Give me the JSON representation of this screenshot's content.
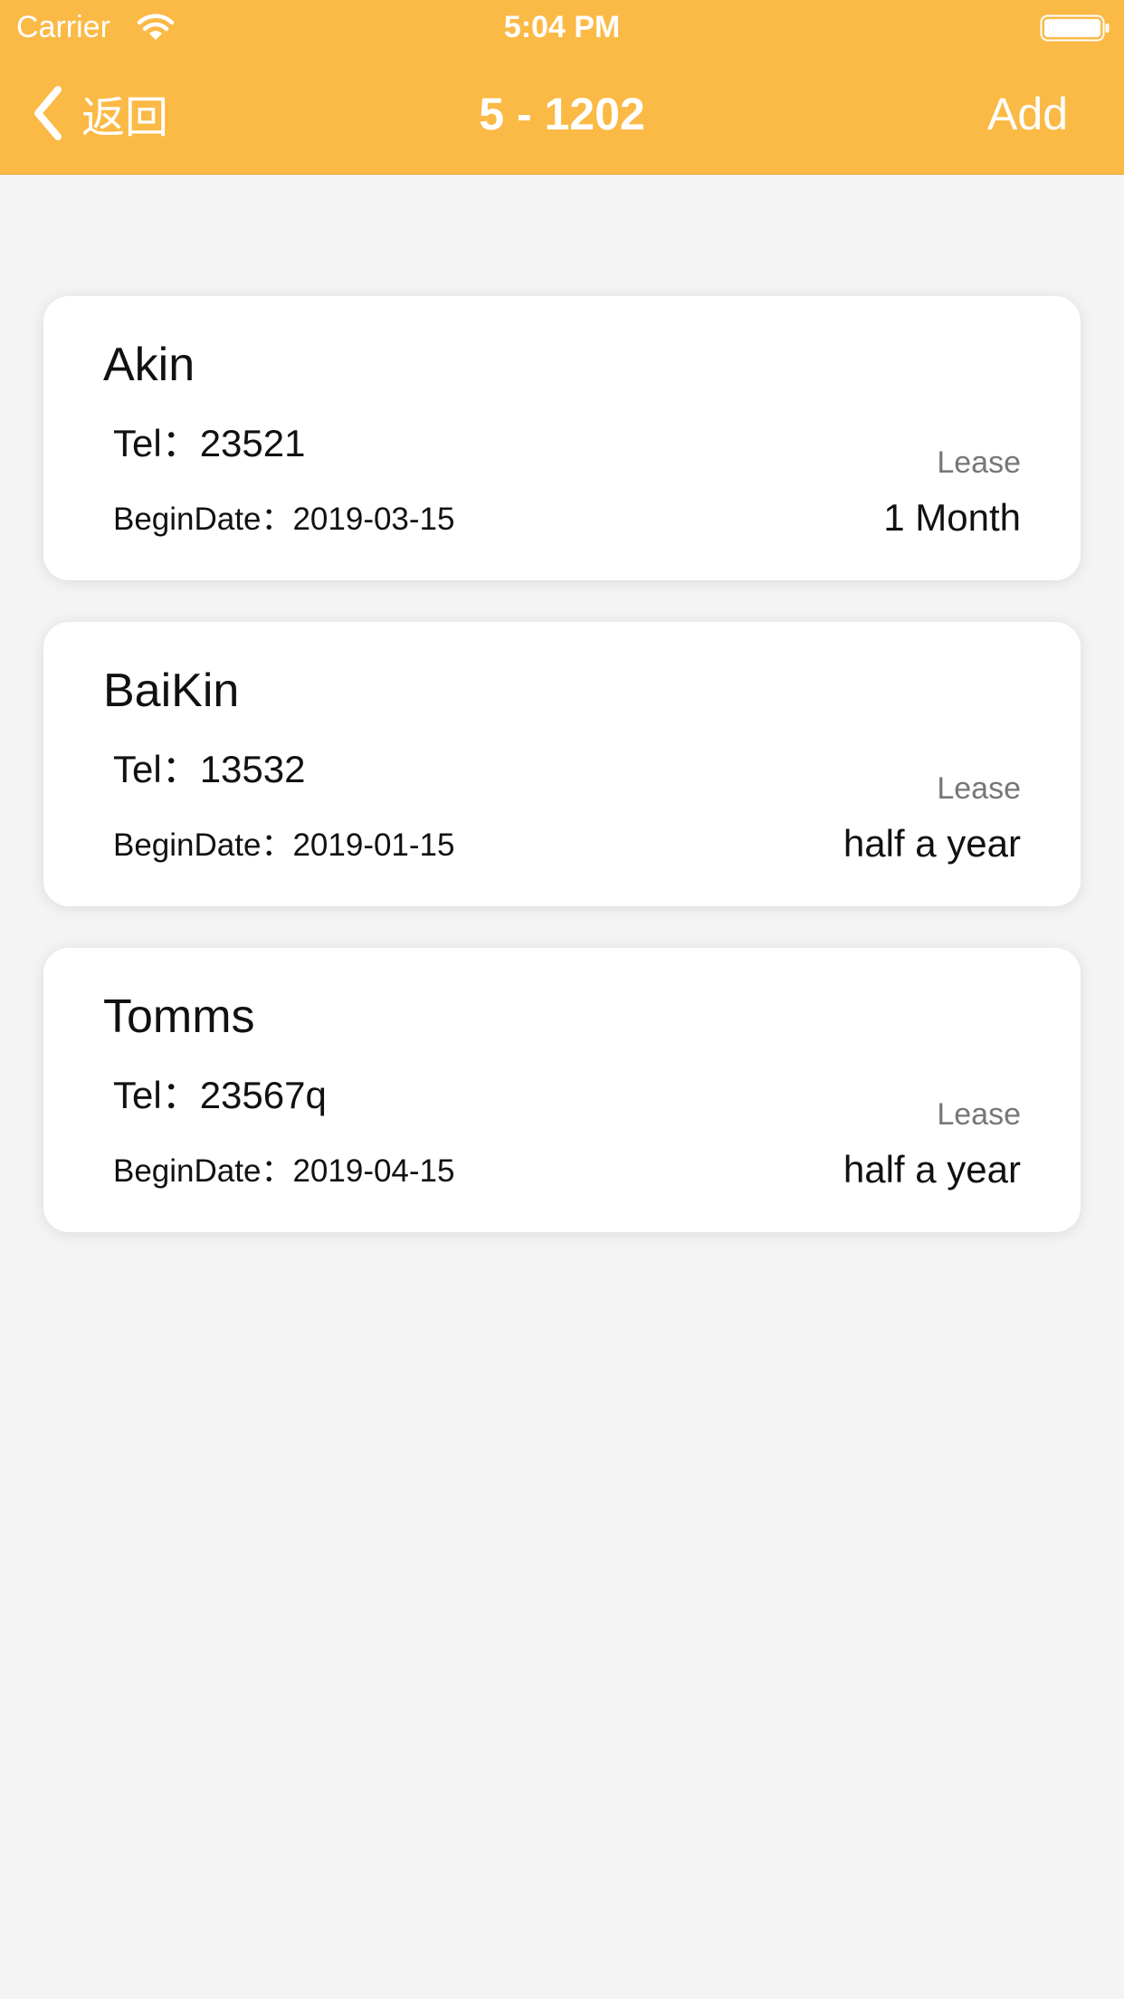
{
  "status_bar": {
    "carrier": "Carrier",
    "time": "5:04 PM"
  },
  "nav": {
    "back_label": "返回",
    "title": "5 - 1202",
    "add_label": "Add"
  },
  "tenants": [
    {
      "name": "Akin",
      "tel_label": "Tel：",
      "tel": "23521",
      "begin_label": "BeginDate：",
      "begin_date": "2019-03-15",
      "lease_label": "Lease",
      "lease": "1 Month"
    },
    {
      "name": "BaiKin",
      "tel_label": "Tel：",
      "tel": "13532",
      "begin_label": "BeginDate：",
      "begin_date": "2019-01-15",
      "lease_label": "Lease",
      "lease": "half a year"
    },
    {
      "name": "Tomms",
      "tel_label": "Tel：",
      "tel": "23567q",
      "begin_label": "BeginDate：",
      "begin_date": "2019-04-15",
      "lease_label": "Lease",
      "lease": "half a year"
    }
  ],
  "colors": {
    "nav_background": "#fbb945",
    "page_background": "#f4f4f4",
    "card_background": "#ffffff"
  },
  "icons": {
    "wifi": "wifi-icon",
    "battery": "battery-icon",
    "back": "chevron-left-icon"
  }
}
